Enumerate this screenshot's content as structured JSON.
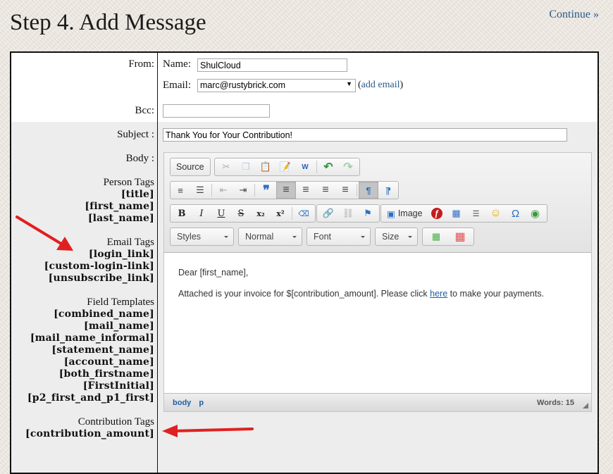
{
  "page": {
    "title": "Step 4. Add Message",
    "continue_label": "Continue »"
  },
  "form": {
    "from_label": "From:",
    "name_label": "Name:",
    "name_value": "ShulCloud",
    "email_label": "Email:",
    "email_selected": "marc@rustybrick.com",
    "add_email_open": "(",
    "add_email_label": "add email",
    "add_email_close": ")",
    "bcc_label": "Bcc:",
    "bcc_value": "",
    "subject_label": "Subject :",
    "subject_value": "Thank You for Your Contribution!",
    "body_label": "Body :"
  },
  "tag_groups": [
    {
      "heading": "Person Tags",
      "tags": [
        "[title]",
        "[first_name]",
        "[last_name]"
      ]
    },
    {
      "heading": "Email Tags",
      "tags": [
        "[login_link]",
        "[custom-login-link]",
        "[unsubscribe_link]"
      ]
    },
    {
      "heading": "Field Templates",
      "tags": [
        "[combined_name]",
        "[mail_name]",
        "[mail_name_informal]",
        "[statement_name]",
        "[account_name]",
        "[both_firstname]",
        "[FirstInitial]",
        "[p2_first_and_p1_first]"
      ]
    },
    {
      "heading": "Contribution Tags",
      "tags": [
        "[contribution_amount]"
      ]
    }
  ],
  "editor": {
    "toolbar": {
      "source_label": "Source",
      "image_label": "Image",
      "styles_label": "Styles",
      "format_label": "Normal",
      "font_label": "Font",
      "size_label": "Size"
    },
    "icons": {
      "cut": "✂",
      "copy": "❐",
      "paste": "📋",
      "paste_text": "📝",
      "paste_word": "W",
      "undo": "↶",
      "redo": "↷",
      "numbered_list": "≡",
      "bulleted_list": "☰",
      "outdent": "⇤",
      "indent": "⇥",
      "blockquote": "❞",
      "align_left": "≡",
      "align_center": "≡",
      "align_right": "≡",
      "justify": "≡",
      "ltr": "¶",
      "rtl": "¶",
      "bold": "B",
      "italic": "I",
      "underline": "U",
      "strike": "S",
      "subscript": "x₂",
      "superscript": "x²",
      "remove_format": "⌫",
      "link": "🔗",
      "unlink": "⛓",
      "anchor": "⚑",
      "flash": "ƒ",
      "table": "▦",
      "hr": "☰",
      "smiley": "☺",
      "special_char": "Ω",
      "iframe": "◉",
      "text_color": "▦",
      "bg_table": "▦"
    },
    "content": {
      "greeting": "Dear [first_name],",
      "line2_before": "Attached is your invoice for $[contribution_amount]. Please click ",
      "line2_link": "here",
      "line2_after": " to make your payments."
    },
    "status": {
      "path": [
        "body",
        "p"
      ],
      "words": "Words: 15"
    }
  },
  "annotation_color": "#e02020"
}
